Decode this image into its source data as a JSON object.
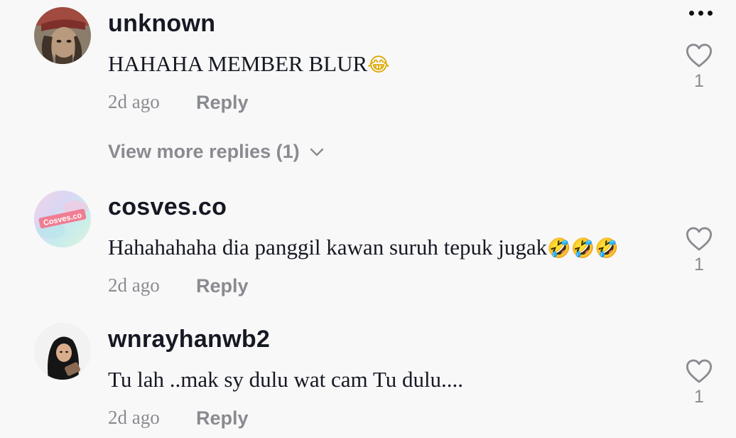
{
  "comments": [
    {
      "username": "unknown",
      "text": "HAHAHA MEMBER BLUR",
      "emoji": "😂",
      "time": "2d ago",
      "reply_label": "Reply",
      "likes": "1",
      "view_more": "View more replies (1)"
    },
    {
      "username": "cosves.co",
      "avatar_text": "Cosves.co",
      "text": "Hahahahaha dia panggil kawan suruh tepuk jugak",
      "emoji": "🤣🤣🤣",
      "time": "2d ago",
      "reply_label": "Reply",
      "likes": "1"
    },
    {
      "username": "wnrayhanwb2",
      "text": "Tu lah ..mak sy dulu wat cam Tu dulu....",
      "time": "2d ago",
      "reply_label": "Reply",
      "likes": "1"
    }
  ],
  "icons": {
    "more": "more-horizontal-icon",
    "like": "heart-outline-icon",
    "expand": "chevron-down-icon"
  },
  "colors": {
    "background": "#f8f8f8",
    "primary_text": "#161823",
    "secondary_text": "#8a8b91"
  }
}
